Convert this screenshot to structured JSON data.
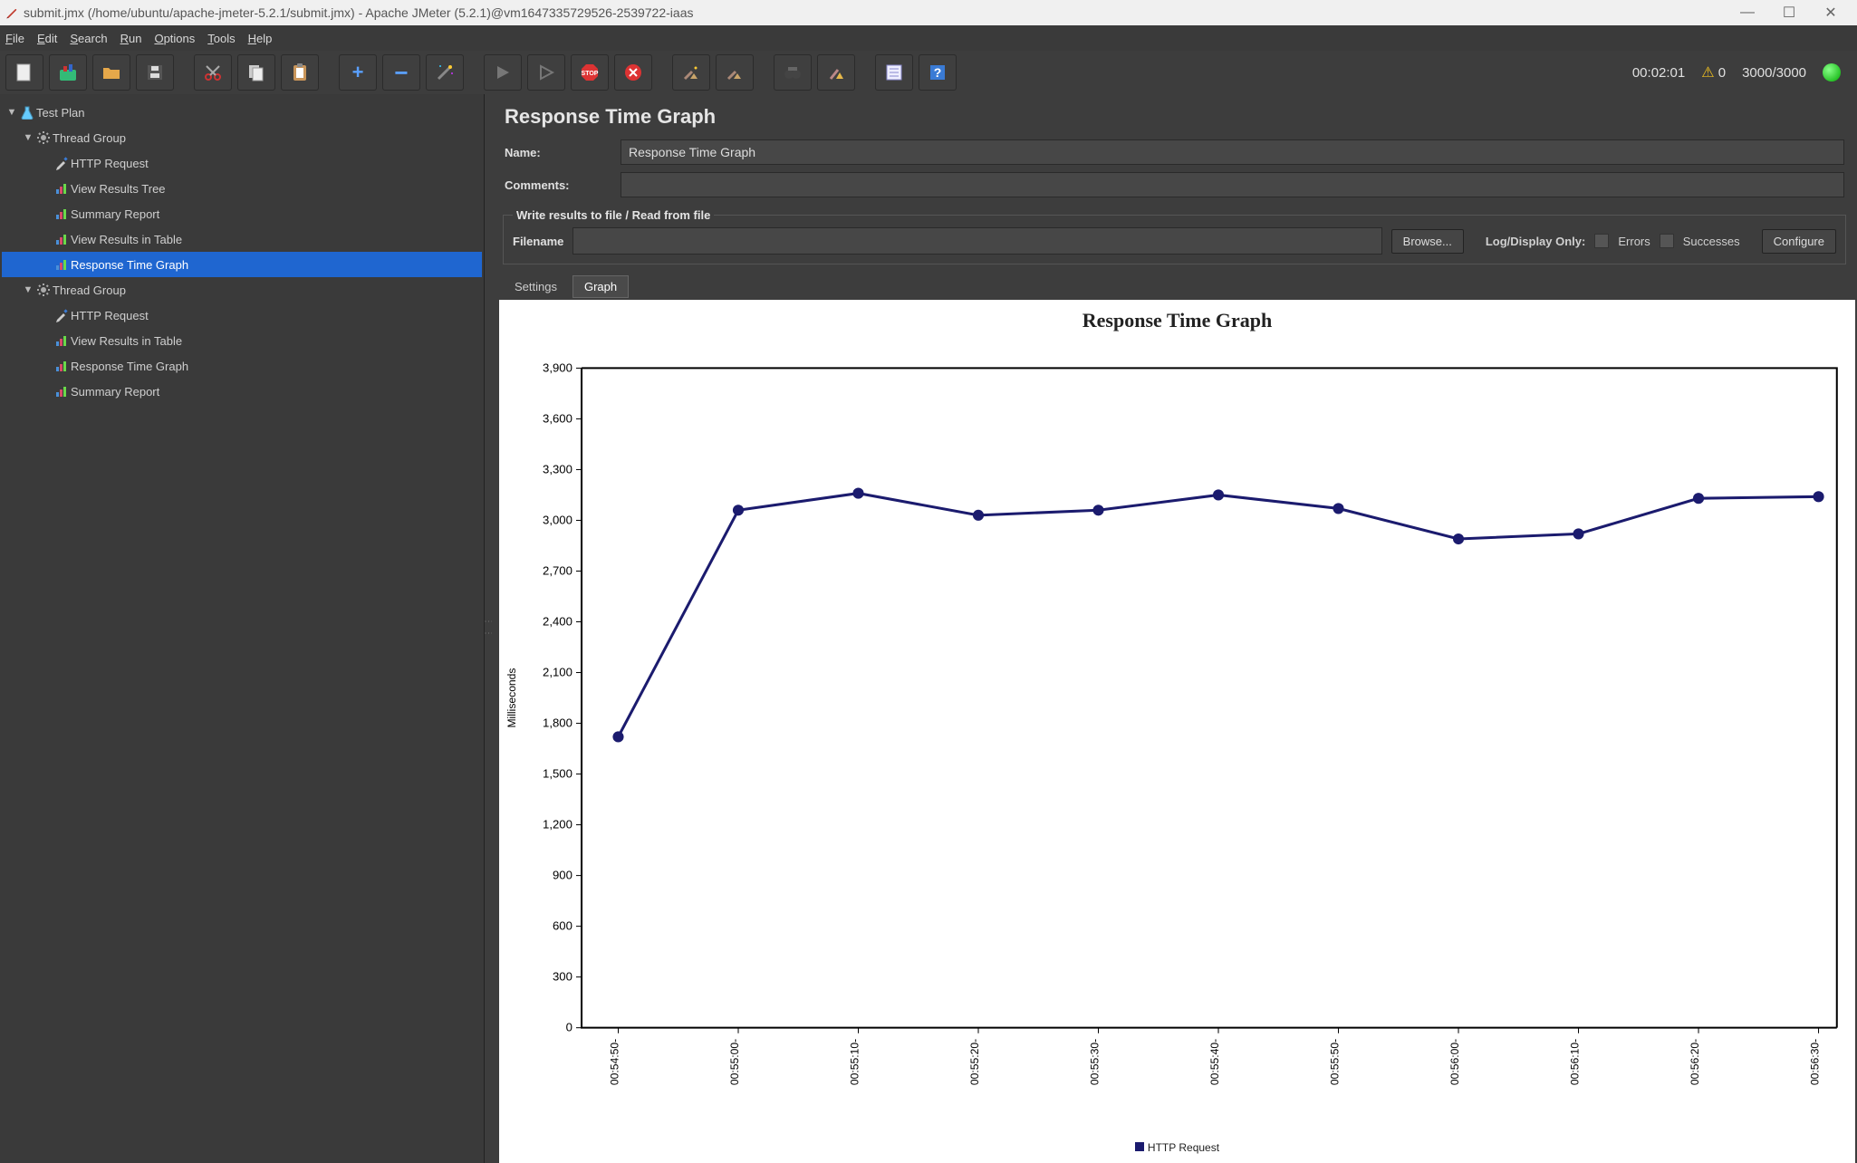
{
  "window": {
    "title": "submit.jmx (/home/ubuntu/apache-jmeter-5.2.1/submit.jmx) - Apache JMeter (5.2.1)@vm1647335729526-2539722-iaas"
  },
  "menu": {
    "file": "File",
    "edit": "Edit",
    "search": "Search",
    "run": "Run",
    "options": "Options",
    "tools": "Tools",
    "help": "Help"
  },
  "status": {
    "elapsed": "00:02:01",
    "warn_count": "0",
    "thread_count": "3000/3000"
  },
  "tree": [
    {
      "label": "Test Plan",
      "icon": "flask",
      "indent": 0,
      "expanded": true
    },
    {
      "label": "Thread Group",
      "icon": "gear",
      "indent": 1,
      "expanded": true
    },
    {
      "label": "HTTP Request",
      "icon": "pipette",
      "indent": 2
    },
    {
      "label": "View Results Tree",
      "icon": "chart",
      "indent": 2
    },
    {
      "label": "Summary Report",
      "icon": "chart",
      "indent": 2
    },
    {
      "label": "View Results in Table",
      "icon": "chart",
      "indent": 2
    },
    {
      "label": "Response Time Graph",
      "icon": "chart",
      "indent": 2,
      "selected": true
    },
    {
      "label": "Thread Group",
      "icon": "gear",
      "indent": 1,
      "expanded": true
    },
    {
      "label": "HTTP Request",
      "icon": "pipette",
      "indent": 2
    },
    {
      "label": "View Results in Table",
      "icon": "chart",
      "indent": 2
    },
    {
      "label": "Response Time Graph",
      "icon": "chart",
      "indent": 2
    },
    {
      "label": "Summary Report",
      "icon": "chart",
      "indent": 2
    }
  ],
  "panel": {
    "title": "Response Time Graph",
    "name_label": "Name:",
    "name_value": "Response Time Graph",
    "comments_label": "Comments:",
    "comments_value": "",
    "fileio_legend": "Write results to file / Read from file",
    "filename_label": "Filename",
    "filename_value": "",
    "browse_btn": "Browse...",
    "logdisplay_label": "Log/Display Only:",
    "errors_label": "Errors",
    "successes_label": "Successes",
    "configure_btn": "Configure"
  },
  "tabs": {
    "settings": "Settings",
    "graph": "Graph",
    "active": "graph"
  },
  "chart_data": {
    "type": "line",
    "title": "Response Time Graph",
    "xlabel": "",
    "ylabel": "Milliseconds",
    "ylim": [
      0,
      3900
    ],
    "yticks": [
      0,
      300,
      600,
      900,
      1200,
      1500,
      1800,
      2100,
      2400,
      2700,
      3000,
      3300,
      3600,
      3900
    ],
    "categories": [
      "00:54:50",
      "00:55:00",
      "00:55:10",
      "00:55:20",
      "00:55:30",
      "00:55:40",
      "00:55:50",
      "00:56:00",
      "00:56:10",
      "00:56:20",
      "00:56:30"
    ],
    "series": [
      {
        "name": "HTTP Request",
        "values": [
          1720,
          3060,
          3160,
          3030,
          3060,
          3150,
          3070,
          2890,
          2920,
          3130,
          3140
        ]
      }
    ],
    "legend_position": "bottom"
  }
}
